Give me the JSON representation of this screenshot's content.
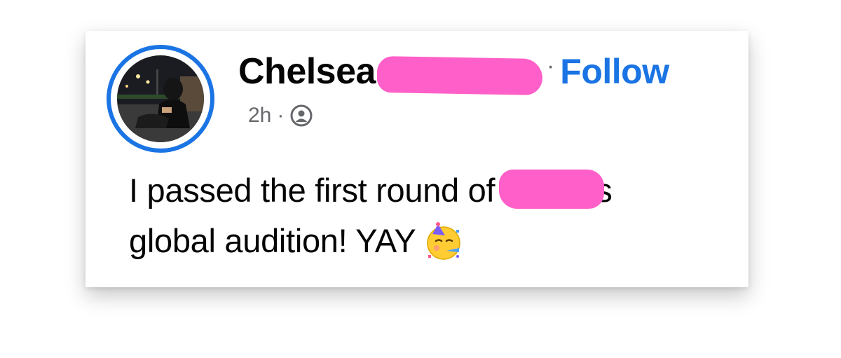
{
  "post": {
    "author_first_name": "Chelsea",
    "separator": "·",
    "follow_label": "Follow",
    "timestamp": "2h",
    "meta_separator": "·",
    "audience_icon": "friends-audience-icon",
    "text_line1_before": "I passed the first round of",
    "text_line1_after": "s",
    "text_line2": "global audition! YAY",
    "emoji": "partying-face-emoji"
  },
  "colors": {
    "follow": "#1b74e4",
    "avatar_ring": "#1b74e4",
    "redaction": "#ff5fc8",
    "secondary_text": "#65676b"
  }
}
